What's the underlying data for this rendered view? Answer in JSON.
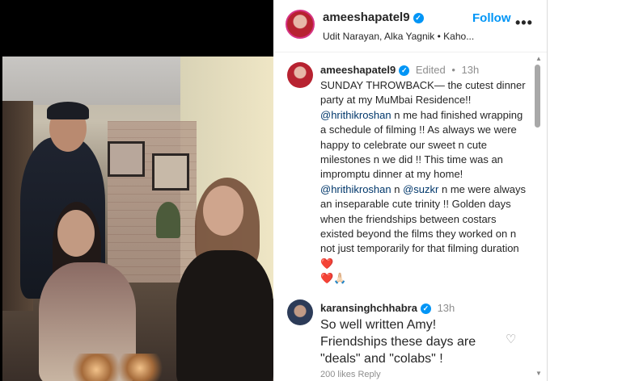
{
  "header": {
    "username": "ameeshapatel9",
    "follow_label": "Follow",
    "subtitle": "Udit Narayan, Alka Yagnik • Kaho...",
    "more_label": "•••"
  },
  "caption": {
    "username": "ameeshapatel9",
    "edited": "Edited",
    "time": "13h",
    "text_1": "SUNDAY THROWBACK— the cutest dinner party at my MuMbai Residence!! ",
    "mention_1": "@hrithikroshan",
    "text_2": " n me had finished wrapping a schedule of filming !! As always we were happy to celebrate our sweet n cute milestones n we did !! This time was an impromptu dinner at my home! ",
    "mention_2": "@hrithikroshan",
    "text_3": " n ",
    "mention_3": "@suzkr",
    "text_4": " n me were always an inseparable cute trinity !! Golden days when the friendships between costars existed beyond the films they worked on n not just temporarily for that filming duration ",
    "emoji_1": "❤️",
    "emoji_2": "❤️",
    "emoji_3": "🙏🏻"
  },
  "comment": {
    "username": "karansinghchhabra",
    "time": "13h",
    "text": "So well written Amy! Friendships these days are \"deals\" and \"colabs\" !",
    "bottom": "200 likes   Reply"
  },
  "icons": {
    "verified": "verified-badge-icon",
    "like": "heart-outline-icon",
    "more": "more-options-icon"
  },
  "colors": {
    "link": "#0095f6",
    "mention": "#00376b",
    "heart": "#e0245e"
  }
}
